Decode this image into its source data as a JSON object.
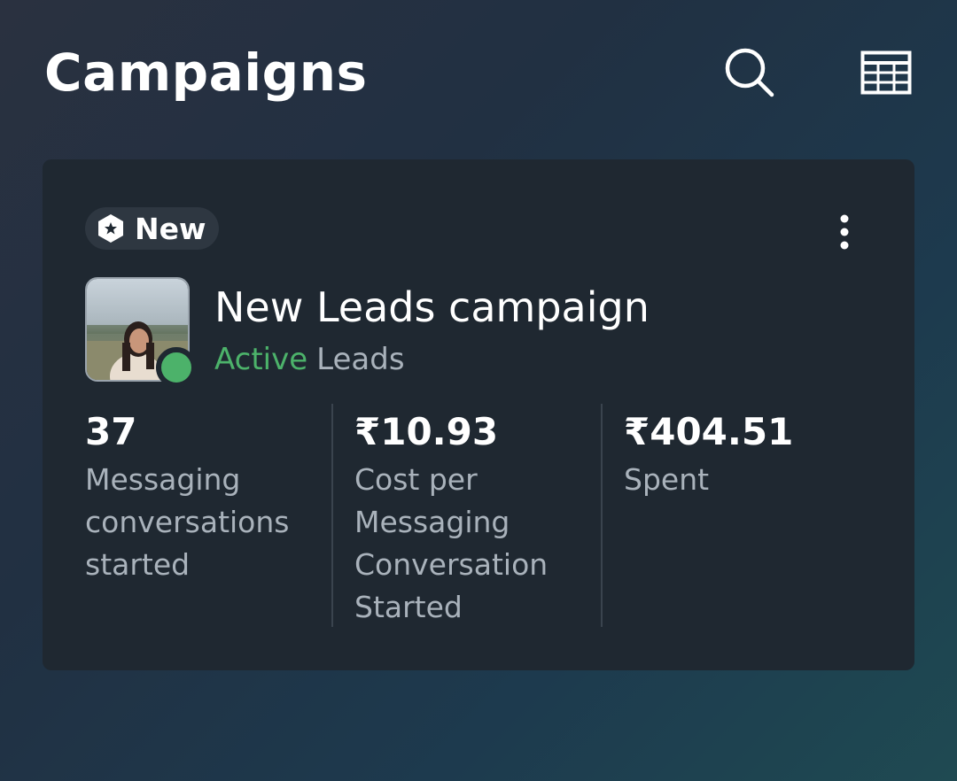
{
  "header": {
    "title": "Campaigns",
    "search_icon": "search-icon",
    "table_icon": "table-view-icon"
  },
  "campaign": {
    "badge_label": "New",
    "badge_icon": "new-hexagon-icon",
    "name": "New Leads campaign",
    "status": "Active",
    "objective": "Leads",
    "status_color": "#4cb26a",
    "metrics": [
      {
        "value": "37",
        "label": "Messaging conversations started"
      },
      {
        "value": "₹10.93",
        "label": "Cost per Messaging Conversation Started"
      },
      {
        "value": "₹404.51",
        "label": "Spent"
      }
    ]
  }
}
